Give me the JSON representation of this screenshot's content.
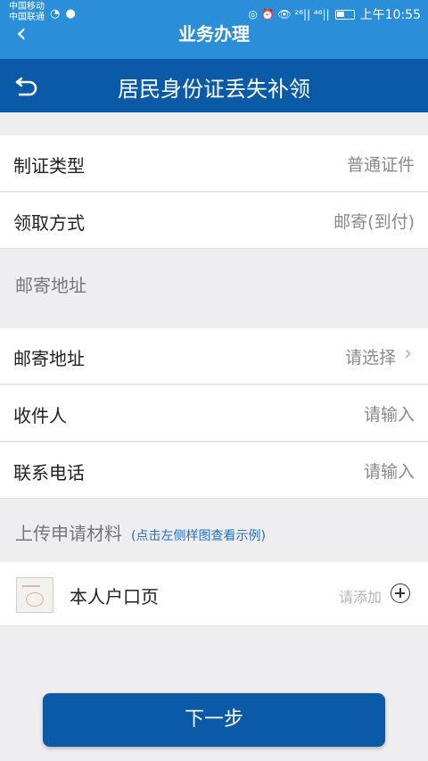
{
  "status_bar": {
    "carrier_1": "中国移动",
    "carrier_2": "中国联通",
    "left_icons": "◔ ●",
    "network": "◎ ⏰ 👁 ²⁶|| ⁴⁶||",
    "time": "上午10:55"
  },
  "outer_bar": {
    "back": "‹",
    "title": "业务办理"
  },
  "header": {
    "title": "居民身份证丢失补领"
  },
  "rows": [
    {
      "label": "制证类型",
      "value": "普通证件"
    },
    {
      "label": "领取方式",
      "value": "邮寄(到付)"
    }
  ],
  "mail_section": {
    "title": "邮寄地址"
  },
  "mail_rows": [
    {
      "label": "邮寄地址",
      "value": "请选择",
      "chevron": true
    },
    {
      "label": "收件人",
      "value": "请输入"
    },
    {
      "label": "联系电话",
      "value": "请输入"
    }
  ],
  "upload_section": {
    "title": "上传申请材料",
    "hint": "(点击左侧样图查看示例)"
  },
  "upload_item": {
    "label": "本人户口页",
    "action": "请添加"
  },
  "next_button": {
    "label": "下一步"
  },
  "colors": {
    "status_bar": "#2a8fd8",
    "header": "#0b5aa8",
    "button": "#0b5aa8",
    "hint": "#1e6fc3"
  }
}
